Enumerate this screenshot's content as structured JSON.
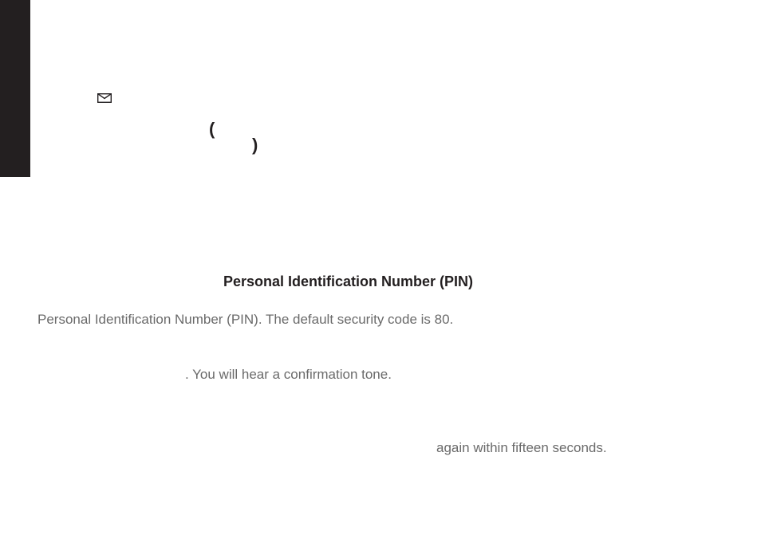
{
  "heading": "Personal Identification Number (PIN)",
  "body": {
    "line1": "Personal Identification Number (PIN). The default security code is 80.",
    "line2": ". You will hear a confirmation tone.",
    "line3": "again within fifteen seconds."
  },
  "punct": {
    "left_paren": "(",
    "right_paren": ")"
  }
}
